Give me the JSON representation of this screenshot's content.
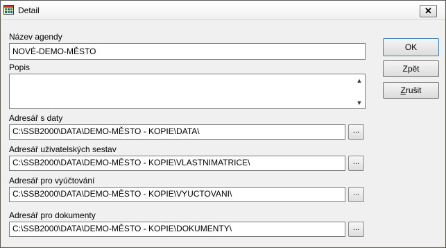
{
  "window": {
    "title": "Detail",
    "icon": "calculator-grid-icon",
    "close_glyph": "✕"
  },
  "form": {
    "nazev_label": "Název agendy",
    "nazev_value": "NOVÉ-DEMO-MĚSTO",
    "popis_label": "Popis",
    "popis_value": "",
    "data_label": "Adresář s daty",
    "data_value": "C:\\SSB2000\\DATA\\DEMO-MĚSTO - KOPIE\\DATA\\",
    "sestavy_label": "Adresář uživatelských sestav",
    "sestavy_value": "C:\\SSB2000\\DATA\\DEMO-MĚSTO - KOPIE\\VLASTNIMATRICE\\",
    "vyuctovani_label": "Adresář pro vyúčtování",
    "vyuctovani_value": "C:\\SSB2000\\DATA\\DEMO-MĚSTO - KOPIE\\VYUCTOVANI\\",
    "dokumenty_label": "Adresář pro dokumenty",
    "dokumenty_value": "C:\\SSB2000\\DATA\\DEMO-MĚSTO - KOPIE\\DOKUMENTY\\",
    "browse_label": "..."
  },
  "buttons": {
    "ok": "OK",
    "back": "Zpět",
    "cancel_first": "Z",
    "cancel_rest": "rušit"
  },
  "colors": {
    "dialog_bg": "#f0f0f0",
    "ok_border": "#3c7fb1"
  }
}
